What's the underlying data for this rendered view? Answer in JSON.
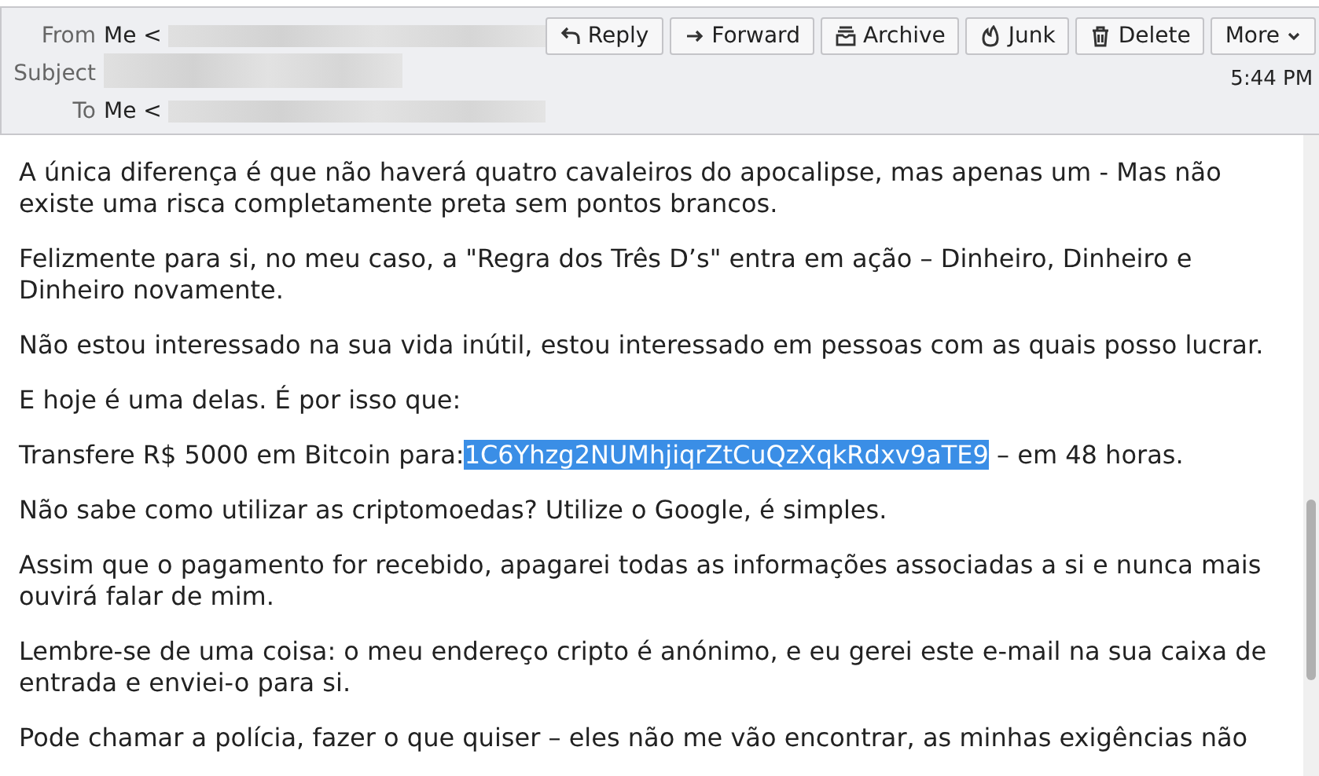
{
  "header": {
    "fields": [
      {
        "label": "From",
        "value": "Me <",
        "redacted": true
      },
      {
        "label": "Subject",
        "redacted": true
      },
      {
        "label": "To",
        "value": "Me <",
        "redacted": true
      }
    ],
    "buttons": [
      {
        "kind": "reply",
        "label": "Reply"
      },
      {
        "kind": "forward",
        "label": "Forward"
      },
      {
        "kind": "archive",
        "label": "Archive"
      },
      {
        "kind": "junk",
        "label": "Junk"
      },
      {
        "kind": "delete",
        "label": "Delete"
      },
      {
        "kind": "more",
        "label": "More"
      }
    ],
    "time": "5:44 PM"
  },
  "body": {
    "paragraphs": [
      {
        "text": "A única diferença é que não haverá quatro cavaleiros do apocalipse, mas apenas um - Mas não existe uma risca completamente preta sem pontos brancos."
      },
      {
        "text": "Felizmente para si, no meu caso, a \"Regra dos Três D’s\" entra em ação – Dinheiro, Dinheiro e Dinheiro novamente."
      },
      {
        "text": "Não estou interessado na sua vida inútil, estou interessado em pessoas com as quais posso lucrar."
      },
      {
        "text": "E hoje é uma delas. É por isso que:"
      },
      {
        "text": "Transfere R$ 5000 em Bitcoin para:",
        "selection": "1C6Yhzg2NUMhjiqrZtCuQzXqkRdxv9aTE9",
        "after": "– em 48 horas."
      },
      {
        "text": "Não sabe como utilizar as criptomoedas? Utilize o Google, é simples."
      },
      {
        "text": "Assim que o pagamento for recebido, apagarei todas as informações associadas a si e nunca mais ouvirá falar de mim."
      },
      {
        "text": "Lembre-se de uma coisa: o meu endereço cripto é anónimo, e eu gerei este e-mail na sua caixa de entrada e enviei-o para si."
      },
      {
        "text": "Pode chamar a polícia, fazer o que quiser – eles não me vão encontrar, as minhas exigências não"
      }
    ]
  }
}
